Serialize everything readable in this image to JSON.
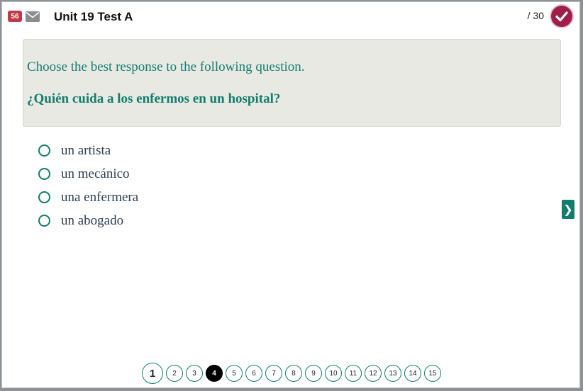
{
  "header": {
    "badge_count": "56",
    "title": "Unit 19 Test A",
    "score": "/ 30",
    "mail_icon": "envelope-icon",
    "submit_icon": "checkmark-icon"
  },
  "question": {
    "instruction": "Choose the best response to the following question.",
    "prompt": "¿Quién cuida a los enfermos en un hospital?"
  },
  "options": [
    {
      "label": "un artista"
    },
    {
      "label": "un mecánico"
    },
    {
      "label": "una enfermera"
    },
    {
      "label": "un abogado"
    }
  ],
  "next_button": {
    "label": "❯"
  },
  "pager": {
    "pages": [
      "1",
      "2",
      "3",
      "4",
      "5",
      "6",
      "7",
      "8",
      "9",
      "10",
      "11",
      "12",
      "13",
      "14",
      "15"
    ],
    "current": "1",
    "active": "4"
  },
  "colors": {
    "accent": "#137d6d",
    "badge": "#c13a47",
    "submit": "#9f1f48",
    "question_bg": "#e9e9e4"
  }
}
